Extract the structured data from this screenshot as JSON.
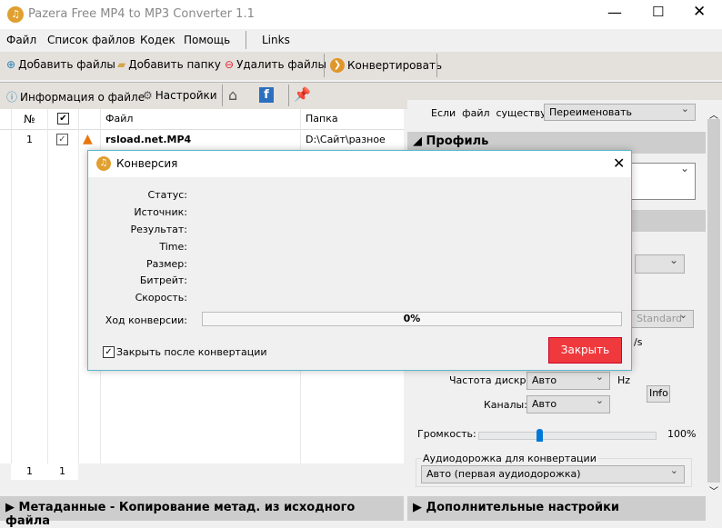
{
  "window": {
    "title": "Pazera Free MP4 to MP3 Converter 1.1"
  },
  "menu": [
    "Файл",
    "Список файлов",
    "Кодек",
    "Помощь",
    "Links"
  ],
  "toolbar1": {
    "add_files": "Добавить файлы",
    "add_folder": "Добавить папку",
    "remove_files": "Удалить файлы",
    "convert": "Конвертировать"
  },
  "toolbar2": {
    "file_info": "Информация о файле",
    "settings": "Настройки"
  },
  "list": {
    "columns": [
      "№",
      "",
      "",
      "Файл",
      "Папка"
    ],
    "rows": [
      {
        "num": "1",
        "file": "rsload.net.MP4",
        "folder": "D:\\Сайт\\разное"
      }
    ],
    "footer": [
      "1",
      "1"
    ]
  },
  "bottom": {
    "metadata": "Метаданные - Копирование метад. из исходного файла",
    "advanced": "Дополнительные настройки"
  },
  "right": {
    "if_exists_label": "Если  файл  существует:",
    "if_exists_value": "Переименовать",
    "profile": "Профиль",
    "standard": "Standard",
    "unit_partial": "/s",
    "sample_rate_label": "Частота дискр.:",
    "sample_rate": "Авто",
    "hz": "Hz",
    "info": "Info",
    "channels_label": "Каналы:",
    "channels": "Авто",
    "volume_label": "Громкость:",
    "volume": "100%",
    "volume_fraction": 0.33,
    "audio_track_group": "Аудиодорожка для конвертации",
    "audio_track": "Авто (первая аудиодорожка)"
  },
  "dialog": {
    "title": "Конверсия",
    "labels": [
      "Статус:",
      "Источник:",
      "Результат:",
      "Time:",
      "Размер:",
      "Битрейт:",
      "Скорость:"
    ],
    "progress_label": "Ход конверсии:",
    "progress": "0%",
    "close_after": "Закрыть после конвертации",
    "close_button": "Закрыть"
  },
  "colors": {
    "accent": "#f0393d",
    "app_icon": "#e0a030"
  }
}
